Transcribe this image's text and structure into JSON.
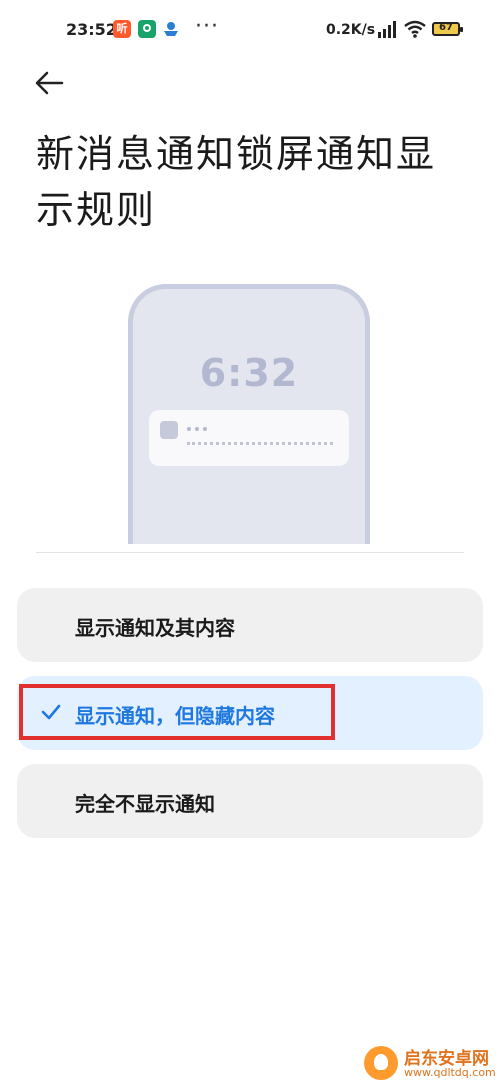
{
  "status_bar": {
    "time": "23:52",
    "app_icon_news": "听",
    "dots": "···",
    "net_speed": "0.2K/s",
    "battery": "67"
  },
  "page": {
    "back_icon": "back-arrow-icon",
    "title": "新消息通知锁屏通知显示规则"
  },
  "illustration": {
    "time": "6:32"
  },
  "options": [
    {
      "label": "显示通知及其内容",
      "selected": false
    },
    {
      "label": "显示通知，但隐藏内容",
      "selected": true
    },
    {
      "label": "完全不显示通知",
      "selected": false
    }
  ],
  "colors": {
    "accent": "#1e78e0",
    "selected_bg": "#e3f0ff",
    "option_bg": "#f0f0f0",
    "highlight_box": "#e0312f"
  },
  "watermark": {
    "text": "启东安卓网",
    "url": "www.qdltdq.com"
  }
}
